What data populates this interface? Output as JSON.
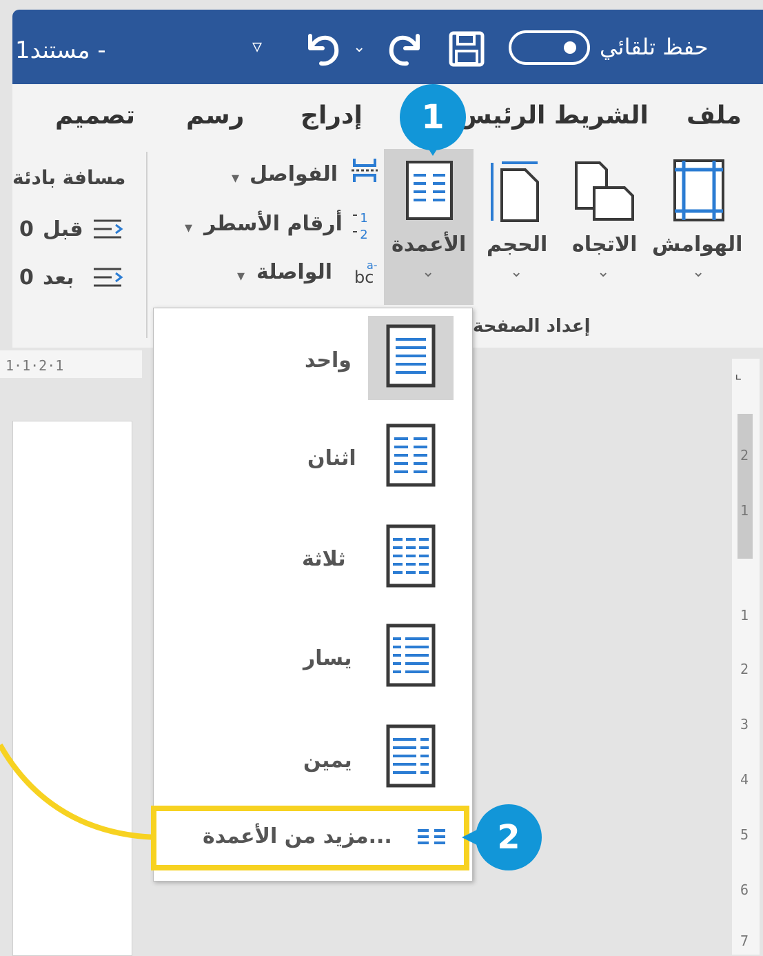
{
  "titlebar": {
    "document_name": "مستند1 -",
    "autosave_label": "حفظ تلقائي",
    "bg_color": "#2b579a"
  },
  "tabs": {
    "file": "ملف",
    "home": "الشريط الرئيس",
    "insert": "إدراج",
    "draw": "رسم",
    "design": "تصميم"
  },
  "ribbon": {
    "margins": "الهوامش",
    "orientation": "الاتجاه",
    "size": "الحجم",
    "columns": "الأعمدة",
    "breaks": "الفواصل",
    "line_numbers": "أرقام الأسطر",
    "hyphenation": "الواصلة",
    "spacing": "مسافة بادئة",
    "before_label": "قبل",
    "before_value": "0",
    "after_label": "بعد",
    "after_value": "0",
    "group_label": "إعداد الصفحة"
  },
  "columns_menu": {
    "options": [
      "واحد",
      "اثنان",
      "ثلاثة",
      "يسار",
      "يمين"
    ],
    "more": "مزيد من الأعمدة...",
    "selected_index": 0
  },
  "callouts": {
    "step1": "1",
    "step2": "2",
    "badge_color": "#1296d8",
    "highlight_color": "#f7d221"
  },
  "rulers": {
    "horizontal": "1·1·2·1",
    "vertical_marks": [
      "2",
      "1",
      "1",
      "2",
      "3",
      "4",
      "5",
      "6",
      "7"
    ]
  }
}
